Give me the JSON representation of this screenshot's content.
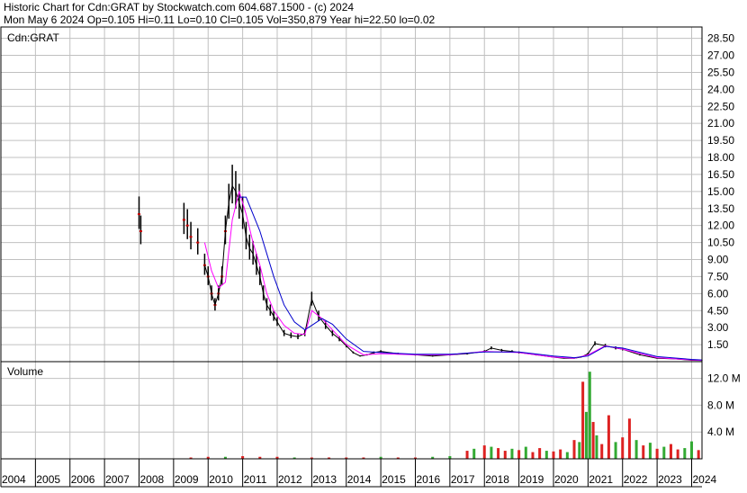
{
  "header": {
    "line1": "Historic Chart for Cdn:GRAT by Stockwatch.com 604.687.1500 - (c) 2024",
    "line2": "Mon May  6 2024   Op=0.105   Hi=0.11   Lo=0.10   Cl=0.105   Vol=350,879   Year hi=22.50   lo=0.02"
  },
  "colors": {
    "grid": "#c0c0c0",
    "price_bar": "#000000",
    "price_dot": "#cc0000",
    "ma_short": "#ff00ff",
    "ma_long": "#0000cc",
    "volume_up": "#33aa33",
    "volume_down": "#dd2222",
    "frame": "#000000"
  },
  "chart_data": [
    {
      "type": "line",
      "panel_label": "Cdn:GRAT",
      "x_labels": [
        "2004",
        "2005",
        "2006",
        "2007",
        "2008",
        "2009",
        "2010",
        "2011",
        "2012",
        "2013",
        "2014",
        "2015",
        "2016",
        "2017",
        "2018",
        "2019",
        "2020",
        "2021",
        "2022",
        "2023",
        "2024"
      ],
      "y_ticks": [
        "28.50",
        "27.00",
        "25.50",
        "24.00",
        "22.50",
        "21.00",
        "19.50",
        "18.00",
        "16.50",
        "15.00",
        "13.50",
        "12.00",
        "10.50",
        "9.00",
        "7.50",
        "6.00",
        "4.50",
        "3.00",
        "1.50"
      ],
      "ylim": [
        0,
        29.5
      ],
      "grid": true,
      "series": [
        {
          "role": "price",
          "x": [
            2008.0,
            2008.05,
            2009.3,
            2009.4,
            2009.5,
            2009.7,
            2009.9,
            2010.0,
            2010.1,
            2010.2,
            2010.3,
            2010.4,
            2010.5,
            2010.6,
            2010.7,
            2010.8,
            2010.9,
            2011.0,
            2011.1,
            2011.2,
            2011.3,
            2011.4,
            2011.5,
            2011.6,
            2011.7,
            2011.8,
            2011.9,
            2012.0,
            2012.2,
            2012.4,
            2012.6,
            2012.8,
            2013.0,
            2013.2,
            2013.4,
            2013.6,
            2013.8,
            2014.0,
            2014.2,
            2014.4,
            2014.6,
            2014.8,
            2015.0,
            2015.5,
            2016.0,
            2016.5,
            2017.0,
            2017.5,
            2018.0,
            2018.2,
            2018.5,
            2018.8,
            2019.0,
            2019.5,
            2020.0,
            2020.3,
            2020.6,
            2020.8,
            2021.0,
            2021.2,
            2021.5,
            2021.8,
            2022.0,
            2022.5,
            2023.0,
            2023.5,
            2024.0,
            2024.3
          ],
          "values": [
            13.0,
            11.5,
            12.5,
            12.0,
            11.0,
            10.5,
            8.5,
            7.5,
            6.0,
            5.0,
            6.0,
            7.5,
            11.5,
            14.0,
            15.5,
            15.0,
            14.0,
            13.0,
            11.0,
            10.0,
            9.5,
            8.5,
            7.5,
            6.0,
            5.0,
            4.5,
            4.0,
            3.5,
            2.5,
            2.3,
            2.2,
            2.5,
            5.5,
            4.0,
            3.2,
            2.5,
            2.0,
            1.4,
            0.8,
            0.5,
            0.6,
            0.8,
            0.9,
            0.7,
            0.6,
            0.5,
            0.6,
            0.7,
            0.9,
            1.2,
            1.0,
            0.9,
            0.8,
            0.6,
            0.4,
            0.3,
            0.3,
            0.4,
            0.7,
            1.6,
            1.4,
            1.2,
            1.1,
            0.6,
            0.3,
            0.25,
            0.12,
            0.105
          ]
        },
        {
          "role": "moving-average-short",
          "x": [
            2009.9,
            2010.1,
            2010.3,
            2010.5,
            2010.7,
            2010.9,
            2011.1,
            2011.3,
            2011.5,
            2011.7,
            2011.9,
            2012.2,
            2012.5,
            2012.8,
            2013.0,
            2013.3,
            2013.6,
            2014.0,
            2014.5,
            2015.0,
            2016.0,
            2017.0,
            2018.0,
            2019.0,
            2020.0,
            2020.6,
            2021.0,
            2021.5,
            2022.0,
            2023.0,
            2024.0,
            2024.3
          ],
          "values": [
            10.5,
            8.0,
            6.5,
            7.0,
            12.5,
            15.0,
            13.0,
            10.5,
            8.5,
            6.0,
            4.5,
            3.2,
            2.5,
            2.4,
            4.5,
            3.8,
            2.8,
            1.5,
            0.6,
            0.7,
            0.6,
            0.6,
            0.9,
            0.8,
            0.4,
            0.3,
            0.6,
            1.4,
            1.1,
            0.35,
            0.15,
            0.11
          ]
        },
        {
          "role": "moving-average-long",
          "x": [
            2010.9,
            2011.1,
            2011.3,
            2011.5,
            2011.7,
            2011.9,
            2012.2,
            2012.5,
            2012.8,
            2013.0,
            2013.3,
            2013.6,
            2014.0,
            2014.5,
            2015.0,
            2016.0,
            2017.0,
            2018.0,
            2019.0,
            2020.0,
            2020.6,
            2021.0,
            2021.5,
            2022.0,
            2023.0,
            2024.0,
            2024.3
          ],
          "values": [
            14.5,
            14.5,
            13.0,
            11.5,
            9.5,
            7.5,
            5.0,
            3.5,
            2.8,
            3.2,
            3.8,
            3.3,
            2.0,
            0.9,
            0.8,
            0.65,
            0.65,
            0.85,
            0.85,
            0.5,
            0.35,
            0.5,
            1.35,
            1.2,
            0.45,
            0.2,
            0.15
          ]
        }
      ]
    },
    {
      "type": "bar",
      "panel_label": "Volume",
      "y_ticks": [
        "12.0 M",
        "8.0 M",
        "4.0 M"
      ],
      "ylim": [
        0,
        14.5
      ],
      "unit": "millions of shares",
      "x": [
        2009.5,
        2010.0,
        2010.5,
        2011.0,
        2011.5,
        2012.0,
        2012.5,
        2013.0,
        2013.5,
        2014.0,
        2014.5,
        2015.0,
        2015.5,
        2016.0,
        2016.5,
        2017.0,
        2017.5,
        2017.7,
        2018.0,
        2018.2,
        2018.4,
        2018.6,
        2018.8,
        2019.0,
        2019.2,
        2019.4,
        2019.6,
        2019.8,
        2020.0,
        2020.2,
        2020.4,
        2020.6,
        2020.75,
        2020.85,
        2020.95,
        2021.05,
        2021.15,
        2021.25,
        2021.4,
        2021.6,
        2021.8,
        2022.0,
        2022.2,
        2022.4,
        2022.6,
        2022.8,
        2023.0,
        2023.2,
        2023.4,
        2023.6,
        2023.8,
        2024.0,
        2024.2
      ],
      "values": [
        0.2,
        0.3,
        0.3,
        0.4,
        0.3,
        0.3,
        0.2,
        0.2,
        0.2,
        0.2,
        0.2,
        0.3,
        0.2,
        0.2,
        0.3,
        0.4,
        1.2,
        1.5,
        2.0,
        1.8,
        1.6,
        1.2,
        1.5,
        1.3,
        1.8,
        1.0,
        1.6,
        1.2,
        1.1,
        1.4,
        1.0,
        2.8,
        2.5,
        11.5,
        7.0,
        13.0,
        5.5,
        3.5,
        2.2,
        6.5,
        2.5,
        3.2,
        6.0,
        2.8,
        2.0,
        2.4,
        1.5,
        1.8,
        2.2,
        1.4,
        1.6,
        2.6,
        1.3
      ],
      "colors": [
        "down",
        "down",
        "up",
        "down",
        "down",
        "down",
        "up",
        "down",
        "down",
        "down",
        "down",
        "up",
        "down",
        "down",
        "up",
        "up",
        "down",
        "up",
        "down",
        "up",
        "down",
        "down",
        "up",
        "down",
        "up",
        "down",
        "down",
        "up",
        "down",
        "down",
        "up",
        "down",
        "up",
        "down",
        "up",
        "up",
        "down",
        "up",
        "down",
        "down",
        "up",
        "down",
        "down",
        "up",
        "down",
        "up",
        "down",
        "up",
        "down",
        "down",
        "up",
        "up",
        "down"
      ]
    }
  ]
}
